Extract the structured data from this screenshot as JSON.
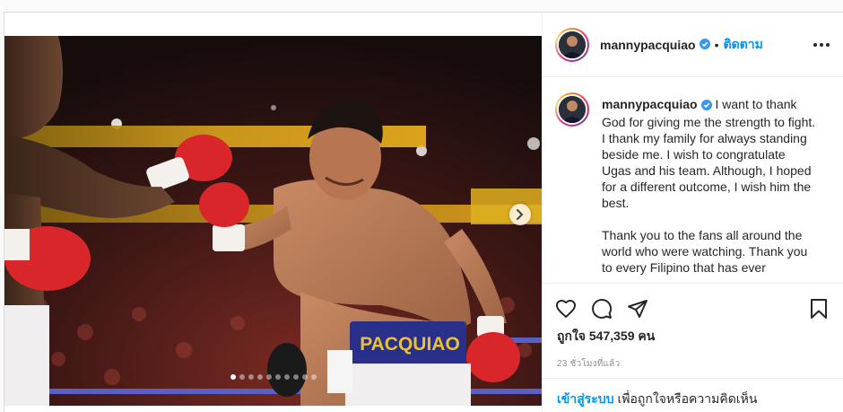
{
  "post": {
    "author": {
      "username": "mannypacquiao",
      "verified": true,
      "avatar_icon": "profile-photo",
      "separator": "•",
      "follow_label": "ติดตาม"
    },
    "caption": {
      "username": "mannypacquiao",
      "paragraphs": [
        "I want to thank God for giving me the strength to fight. I thank my family for always standing beside me. I wish to congratulate Ugas and his team. Although, I hoped for a different outcome, I wish him the best.",
        "Thank you to the fans all around the world who were watching. Thank you to every Filipino that has ever"
      ]
    },
    "media": {
      "trunks_text": "PACQUIAO",
      "carousel_total": 10,
      "carousel_active": 1
    },
    "likes_text": "ถูกใจ 547,359 คน",
    "timestamp": "23 ชั่วโมงที่แล้ว",
    "login_prompt": {
      "link": "เข้าสู่ระบบ",
      "text": " เพื่อถูกใจหรือความคิดเห็น"
    }
  },
  "colors": {
    "accent": "#0095f6",
    "verified_badge": "#3897f0",
    "text_primary": "#262626",
    "text_secondary": "#8e8e8e",
    "border": "#dbdbdb",
    "glove_red": "#d9262a",
    "trunks_blue": "#2a2f8a",
    "trunks_gold": "#e8c234"
  }
}
